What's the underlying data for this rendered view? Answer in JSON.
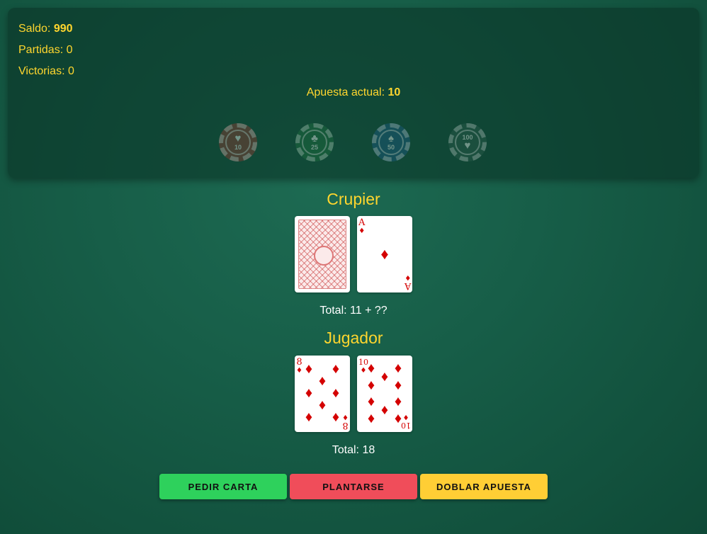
{
  "stats": {
    "balance_label": "Saldo: ",
    "balance_value": "990",
    "games_label": "Partidas: 0",
    "wins_label": "Victorias: 0"
  },
  "bet": {
    "label": "Apuesta actual: ",
    "value": "10"
  },
  "chips": [
    {
      "value": "10",
      "suit": "♥",
      "color": "#8a3b32"
    },
    {
      "value": "25",
      "suit": "♣",
      "color": "#1e6e3e"
    },
    {
      "value": "50",
      "suit": "♠",
      "color": "#1c5a80"
    },
    {
      "value": "100",
      "suit": "♥",
      "color": "#2a5a4a"
    }
  ],
  "dealer": {
    "title": "Crupier",
    "total": "Total: 11 + ??",
    "cards": [
      {
        "hidden": true
      },
      {
        "rank": "A",
        "suit": "♦"
      }
    ]
  },
  "player": {
    "title": "Jugador",
    "total": "Total: 18",
    "cards": [
      {
        "rank": "8",
        "suit": "♦"
      },
      {
        "rank": "10",
        "suit": "♦"
      }
    ]
  },
  "actions": {
    "hit": "PEDIR CARTA",
    "stand": "PLANTARSE",
    "double": "DOBLAR APUESTA"
  },
  "colors": {
    "accent": "#ffd62e",
    "hit": "#2ed15c",
    "stand": "#f04d5a",
    "double": "#ffce35",
    "suit_red": "#d40000"
  }
}
